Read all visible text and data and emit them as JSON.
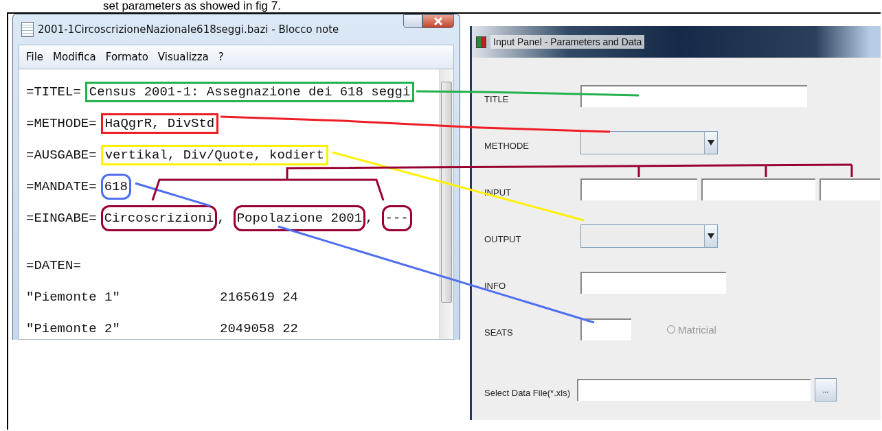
{
  "caption": "set parameters as showed in fig 7.",
  "notepad": {
    "title": "2001-1CircoscrizioneNazionale618seggi.bazi - Blocco note",
    "menu": [
      {
        "label": "File"
      },
      {
        "label": "Modifica"
      },
      {
        "label": "Formato"
      },
      {
        "label": "Visualizza"
      },
      {
        "label": "?"
      }
    ],
    "lines": [
      {
        "kind": "entry",
        "key": "=TITEL=",
        "segments": [
          {
            "kind": "boxed",
            "text": "Census 2001-1: Assegnazione dei 618 seggi",
            "color": "#22b14c"
          }
        ]
      },
      {
        "kind": "entry",
        "key": "=METHODE=",
        "segments": [
          {
            "kind": "boxed",
            "text": "HaQgrR, DivStd",
            "color": "#ee1c24"
          }
        ]
      },
      {
        "kind": "entry",
        "key": "=AUSGABE=",
        "segments": [
          {
            "kind": "boxed",
            "text": "vertikal, Div/Quote, kodiert",
            "color": "#fff200"
          }
        ]
      },
      {
        "kind": "entry",
        "key": "=MANDATE=",
        "segments": [
          {
            "kind": "rounded",
            "text": "618",
            "color": "#4f6ff0"
          }
        ]
      },
      {
        "kind": "entry",
        "key": "=EINGABE=",
        "segments": [
          {
            "kind": "rounded",
            "text": "Circoscrizioni",
            "color": "#990030"
          },
          {
            "kind": "plain",
            "text": ","
          },
          {
            "kind": "rounded",
            "text": "Popolazione 2001",
            "color": "#990030"
          },
          {
            "kind": "plain",
            "text": ","
          },
          {
            "kind": "rounded",
            "text": "---",
            "color": "#990030"
          }
        ]
      },
      {
        "kind": "blank"
      },
      {
        "kind": "entry",
        "key": "=DATEN="
      },
      {
        "kind": "data",
        "key": "\"Piemonte 1\"",
        "segments": [
          {
            "kind": "column",
            "text": "2165619 24"
          }
        ]
      },
      {
        "kind": "data",
        "key": "\"Piemonte 2\"",
        "segments": [
          {
            "kind": "column",
            "text": "2049058 22"
          }
        ]
      }
    ]
  },
  "panel": {
    "title": "Input Panel - Parameters and Data",
    "rows": [
      {
        "kind": "text",
        "label": "TITLE"
      },
      {
        "kind": "combo",
        "label": "METHODE"
      },
      {
        "kind": "triple",
        "label": "INPUT"
      },
      {
        "kind": "combo",
        "label": "OUTPUT"
      },
      {
        "kind": "short",
        "label": "INFO"
      },
      {
        "kind": "seats",
        "label": "SEATS",
        "option": {
          "label": "Matricial",
          "selected": false
        }
      },
      {
        "kind": "file",
        "label": "Select Data File(*.xls)",
        "button": "..."
      }
    ]
  }
}
